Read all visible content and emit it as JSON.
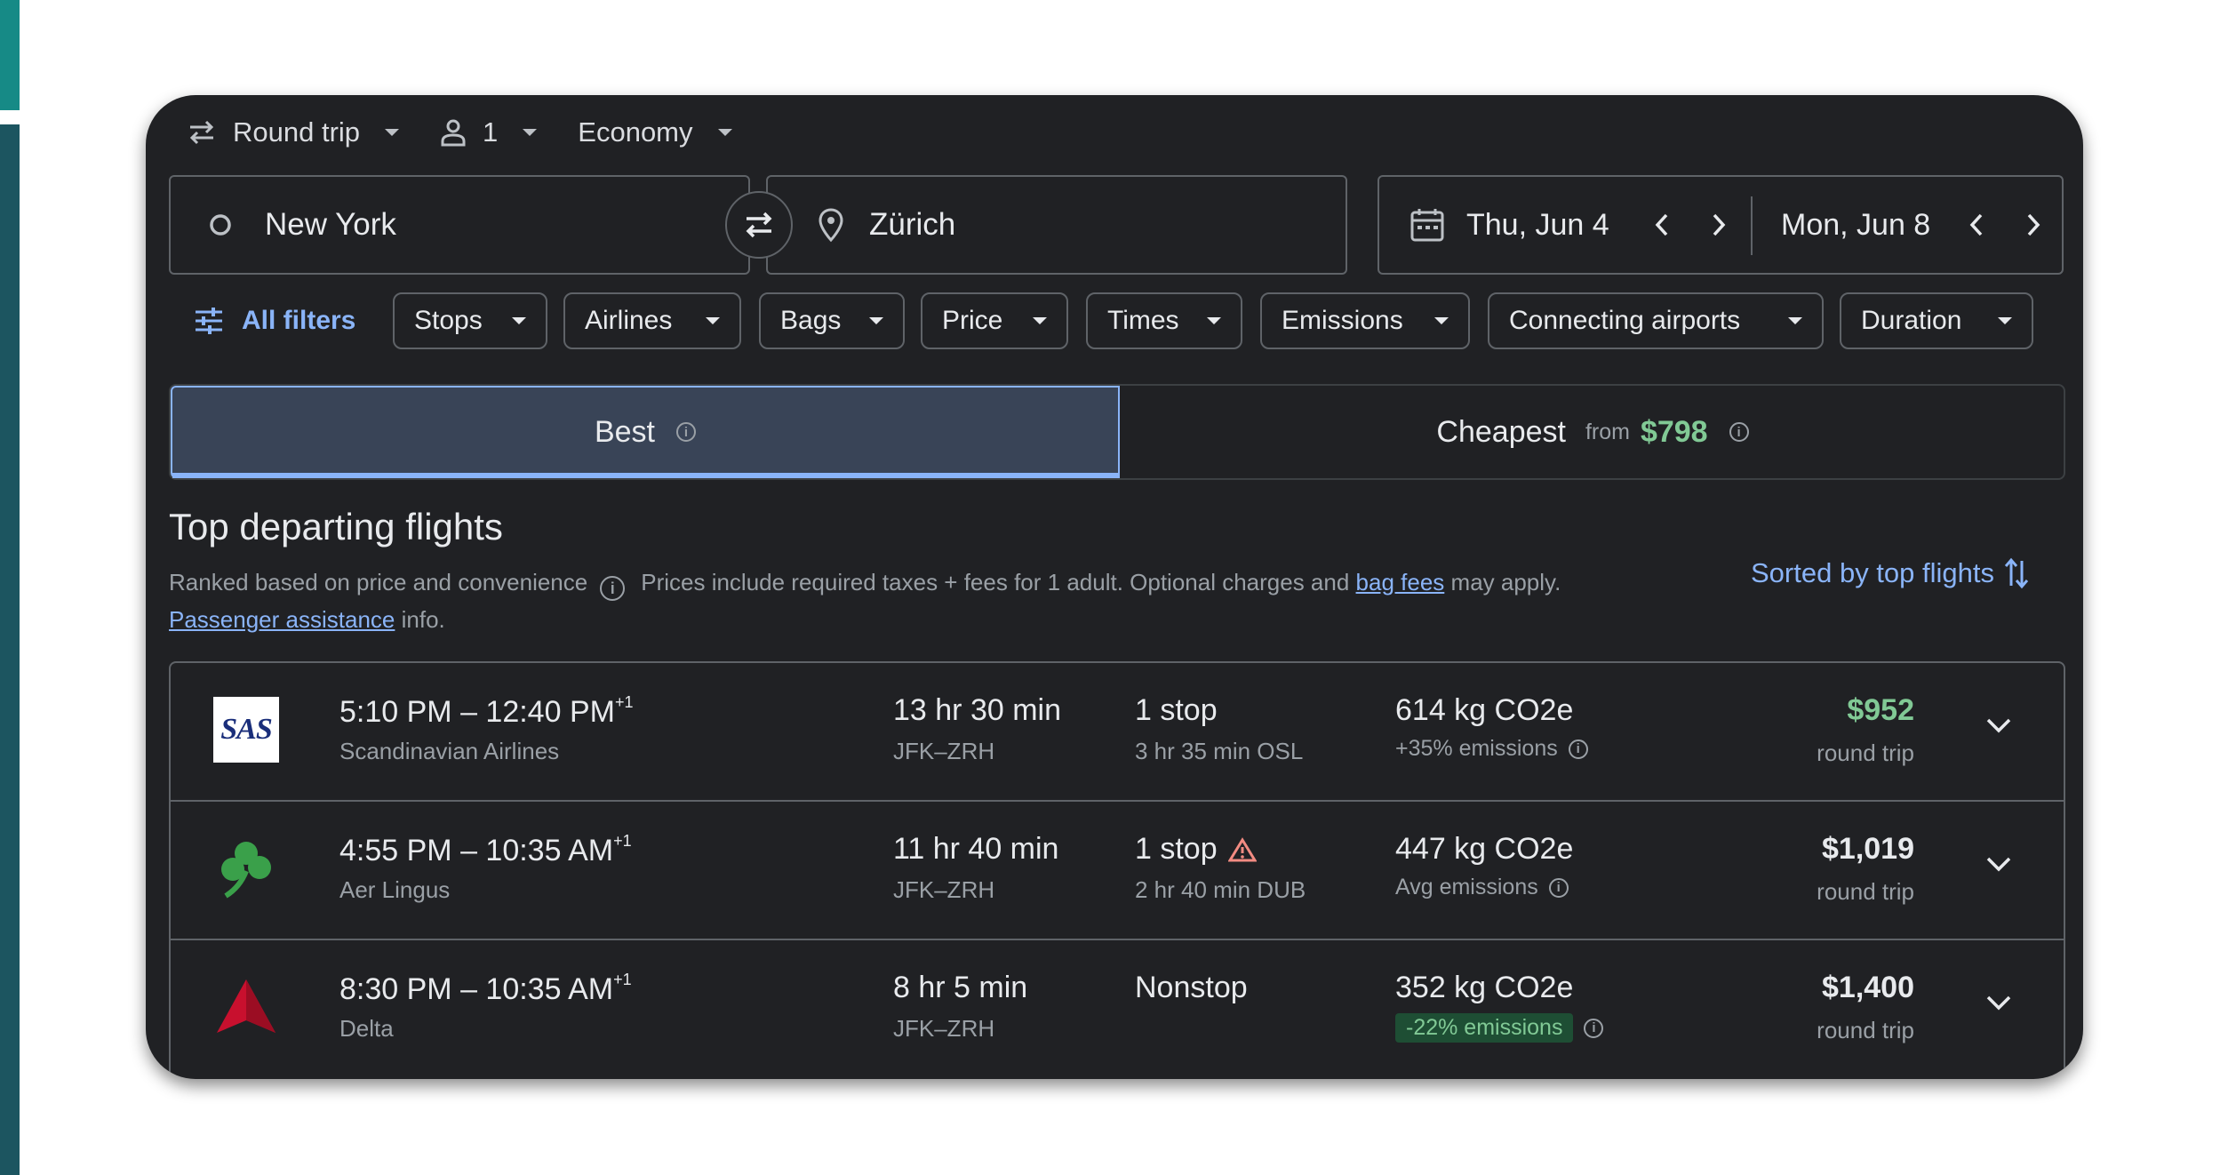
{
  "search": {
    "trip_type": "Round trip",
    "passengers": "1",
    "cabin": "Economy",
    "origin": "New York",
    "destination": "Zürich",
    "depart_date": "Thu, Jun 4",
    "return_date": "Mon, Jun 8"
  },
  "filters": {
    "all_filters": "All filters",
    "chips": [
      "Stops",
      "Airlines",
      "Bags",
      "Price",
      "Times",
      "Emissions",
      "Connecting airports",
      "Duration"
    ]
  },
  "tabs": {
    "best": "Best",
    "cheapest": "Cheapest",
    "cheapest_from": "from",
    "cheapest_price": "$798"
  },
  "section": {
    "title": "Top departing flights",
    "ranked": "Ranked based on price and convenience",
    "prices_note": "Prices include required taxes + fees for 1 adult. Optional charges and",
    "bag_fees": "bag fees",
    "may_apply": "may apply.",
    "passenger_assistance": "Passenger assistance",
    "info_suffix": "info.",
    "sorted": "Sorted by top flights"
  },
  "flights": [
    {
      "times": "5:10 PM – 12:40 PM",
      "day_offset": "+1",
      "airline": "Scandinavian Airlines",
      "logo": "sas-logo",
      "duration": "13 hr 30 min",
      "route": "JFK–ZRH",
      "stops": "1 stop",
      "stop_detail": "3 hr 35 min OSL",
      "emissions": "614 kg CO2e",
      "emissions_note": "+35% emissions",
      "price": "$952",
      "price_label": "round trip"
    },
    {
      "times": "4:55 PM – 10:35 AM",
      "day_offset": "+1",
      "airline": "Aer Lingus",
      "logo": "shamrock-logo",
      "duration": "11 hr 40 min",
      "route": "JFK–ZRH",
      "stops": "1 stop",
      "stop_detail": "2 hr 40 min DUB",
      "emissions": "447 kg CO2e",
      "emissions_note": "Avg emissions",
      "price": "$1,019",
      "price_label": "round trip"
    },
    {
      "times": "8:30 PM – 10:35 AM",
      "day_offset": "+1",
      "airline": "Delta",
      "logo": "delta-logo",
      "duration": "8 hr 5 min",
      "route": "JFK–ZRH",
      "stops": "Nonstop",
      "stop_detail": "",
      "emissions": "352 kg CO2e",
      "emissions_note": "-22% emissions",
      "price": "$1,400",
      "price_label": "round trip"
    }
  ],
  "colors": {
    "background": "#202124",
    "accent_blue": "#8ab4f8",
    "accent_green": "#81c995",
    "warning": "#f28b82"
  }
}
